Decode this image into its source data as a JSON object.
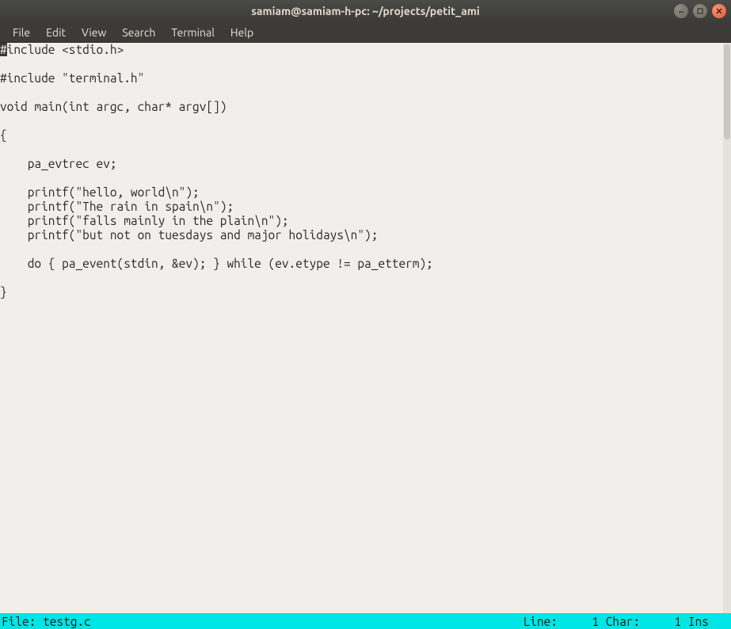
{
  "window": {
    "title": "samiam@samiam-h-pc: ~/projects/petit_ami"
  },
  "menu": {
    "file": "File",
    "edit": "Edit",
    "view": "View",
    "search": "Search",
    "terminal": "Terminal",
    "help": "Help"
  },
  "code_lines": [
    {
      "cursor_char": "#",
      "rest": "include <stdio.h>"
    },
    {
      "text": ""
    },
    {
      "text": "#include \"terminal.h\""
    },
    {
      "text": ""
    },
    {
      "text": "void main(int argc, char* argv[])"
    },
    {
      "text": ""
    },
    {
      "text": "{"
    },
    {
      "text": ""
    },
    {
      "text": "    pa_evtrec ev;"
    },
    {
      "text": ""
    },
    {
      "text": "    printf(\"hello, world\\n\");"
    },
    {
      "text": "    printf(\"The rain in spain\\n\");"
    },
    {
      "text": "    printf(\"falls mainly in the plain\\n\");"
    },
    {
      "text": "    printf(\"but not on tuesdays and major holidays\\n\");"
    },
    {
      "text": ""
    },
    {
      "text": "    do { pa_event(stdin, &ev); } while (ev.etype != pa_etterm);"
    },
    {
      "text": ""
    },
    {
      "text": "}"
    }
  ],
  "status": {
    "file_label": "File: ",
    "file_name": "testg.c",
    "line_label": "Line:",
    "line_value": "1",
    "char_label": "Char:",
    "char_value": "1",
    "mode": "Ins"
  }
}
